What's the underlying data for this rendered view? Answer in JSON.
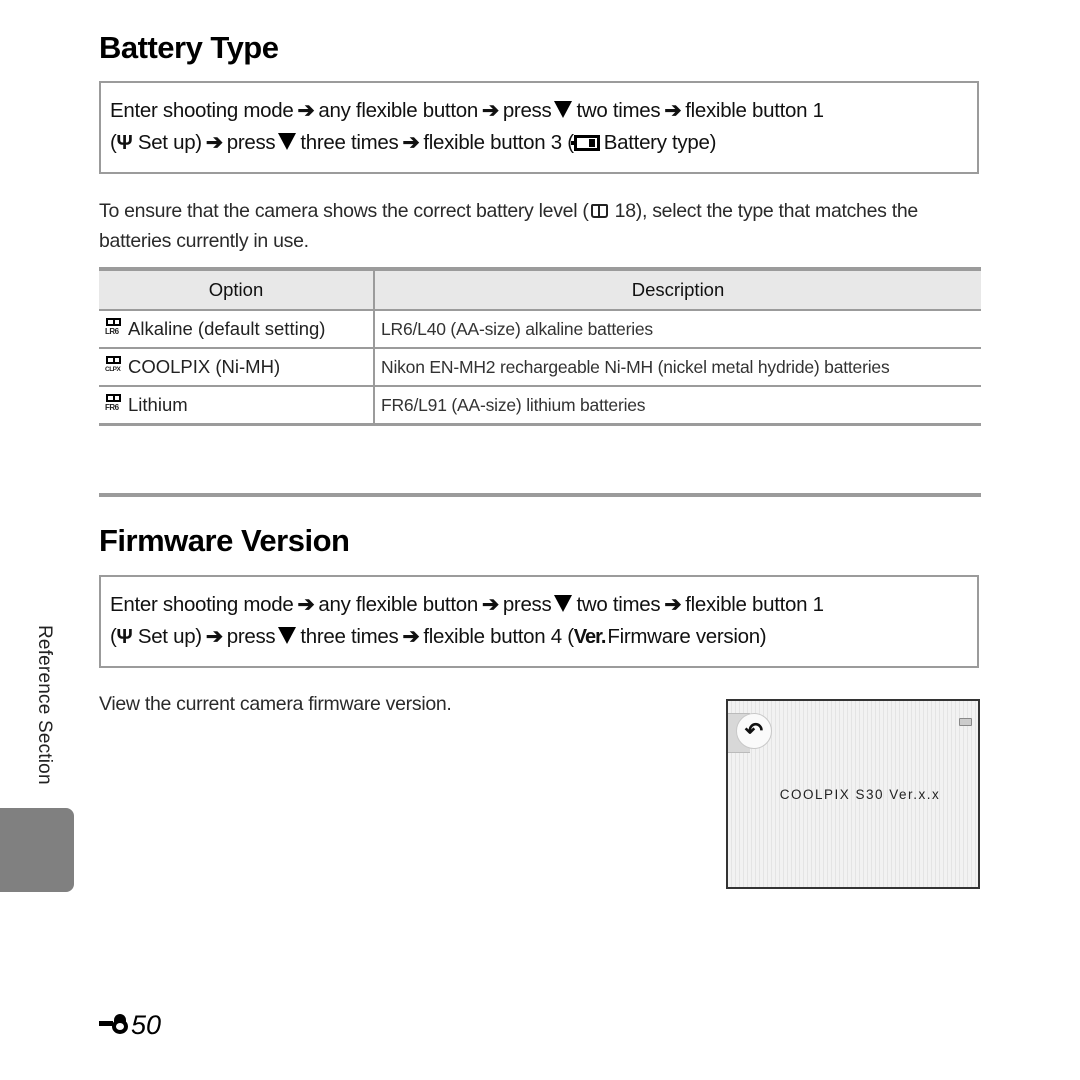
{
  "battery_section": {
    "title": "Battery Type",
    "nav": {
      "line1_a": "Enter shooting mode",
      "line1_b": "any flexible button",
      "line1_c": "press",
      "line1_d": "two times",
      "line1_e": "flexible button 1",
      "line2_a": "Set up)",
      "line2_b": "press",
      "line2_c": "three times",
      "line2_d": "flexible button 3 (",
      "line2_e": "Battery type)"
    },
    "intro_a": "To ensure that the camera shows the correct battery level (",
    "intro_page_ref": "18",
    "intro_b": "), select the type that matches the batteries currently in use.",
    "table": {
      "headers": [
        "Option",
        "Description"
      ],
      "rows": [
        {
          "icon": "battery-lr6-icon",
          "icon_label": "LR6",
          "option": "Alkaline (default setting)",
          "description": "LR6/L40 (AA-size) alkaline batteries"
        },
        {
          "icon": "battery-clpx-icon",
          "icon_label": "CLPX",
          "option": "COOLPIX (Ni-MH)",
          "description": "Nikon EN-MH2 rechargeable Ni-MH (nickel metal hydride) batteries"
        },
        {
          "icon": "battery-fr6-icon",
          "icon_label": "FR6",
          "option": "Lithium",
          "description": "FR6/L91 (AA-size) lithium batteries"
        }
      ]
    }
  },
  "firmware_section": {
    "title": "Firmware Version",
    "nav": {
      "line1_a": "Enter shooting mode",
      "line1_b": "any flexible button",
      "line1_c": "press",
      "line1_d": "two times",
      "line1_e": "flexible button 1",
      "line2_a": "Set up)",
      "line2_b": "press",
      "line2_c": "three times",
      "line2_d": "flexible button 4 (",
      "ver_icon": "Ver.",
      "line2_e": "Firmware version)"
    },
    "description": "View the current camera firmware version.",
    "screen": {
      "back_symbol": "↶",
      "firmware_text": "COOLPIX S30 Ver.x.x"
    }
  },
  "side_label": "Reference Section",
  "page_number": "50",
  "symbols": {
    "arrow": "➔",
    "wrench": "Ÿ",
    "paren_open": "("
  }
}
